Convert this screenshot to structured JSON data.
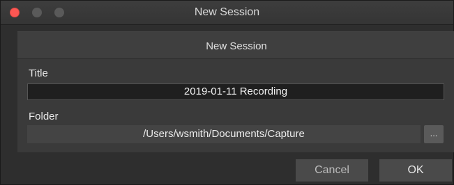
{
  "window": {
    "title": "New Session"
  },
  "dialog": {
    "header": "New Session",
    "title_label": "Title",
    "title_value": "2019-01-11 Recording",
    "folder_label": "Folder",
    "folder_value": "/Users/wsmith/Documents/Capture",
    "browse_label": "...",
    "cancel_label": "Cancel",
    "ok_label": "OK"
  },
  "colors": {
    "close": "#fc5753",
    "inactive": "#5a5a5a",
    "background": "#2e2e2e"
  }
}
